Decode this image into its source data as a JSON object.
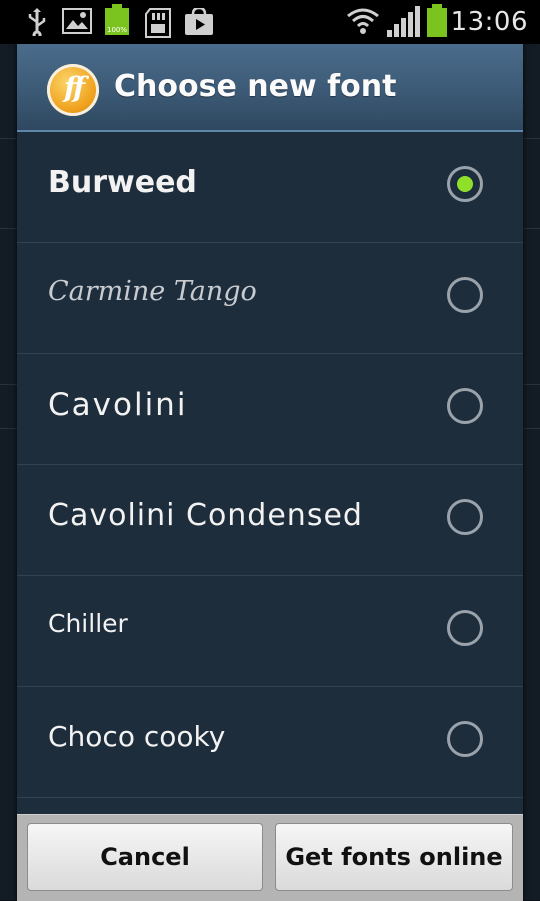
{
  "status_bar": {
    "time": "13:06",
    "icons": [
      "usb-icon",
      "gallery-icon",
      "battery-100-icon",
      "sd-card-icon",
      "play-store-icon",
      "wifi-icon",
      "signal-icon",
      "battery-icon"
    ],
    "battery_badge": "100%"
  },
  "dialog": {
    "title": "Choose new font",
    "logo_text": "ff",
    "fonts": [
      {
        "name": "Burweed",
        "selected": true
      },
      {
        "name": "Carmine Tango",
        "selected": false
      },
      {
        "name": "Cavolini",
        "selected": false
      },
      {
        "name": "Cavolini Condensed",
        "selected": false
      },
      {
        "name": "Chiller",
        "selected": false
      },
      {
        "name": "Choco cooky",
        "selected": false
      }
    ],
    "buttons": {
      "cancel": "Cancel",
      "get_fonts": "Get fonts online"
    }
  },
  "colors": {
    "radio_selected": "#8fe02a",
    "dialog_bg": "#1e2d3c",
    "header": "#3c5a76"
  }
}
